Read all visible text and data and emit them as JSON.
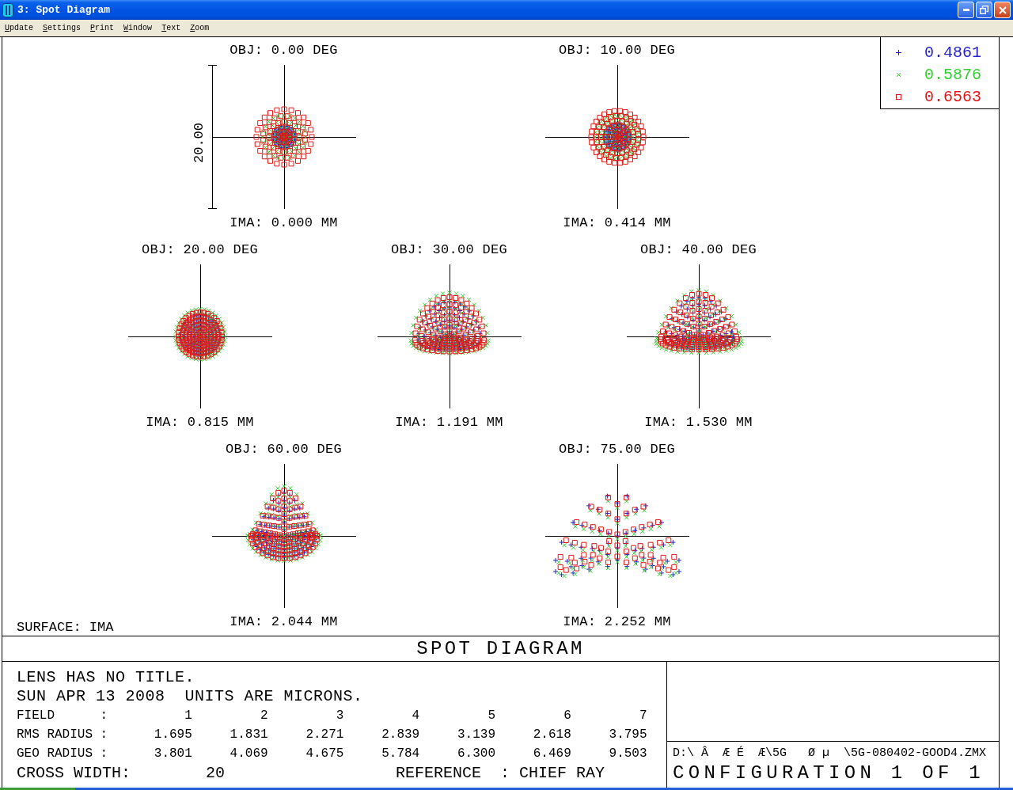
{
  "window": {
    "title": "3: Spot Diagram"
  },
  "menu": [
    "Update",
    "Settings",
    "Print",
    "Window",
    "Text",
    "Zoom"
  ],
  "plot": {
    "scale_label": "20.00",
    "surface": "SURFACE: IMA",
    "fields": [
      {
        "title": "OBJ: 0.00 DEG",
        "image_height": "IMA: 0.000 MM"
      },
      {
        "title": "OBJ: 10.00 DEG",
        "image_height": "IMA: 0.414 MM"
      },
      {
        "title": "OBJ: 20.00 DEG",
        "image_height": "IMA: 0.815 MM"
      },
      {
        "title": "OBJ: 30.00 DEG",
        "image_height": "IMA: 1.191 MM"
      },
      {
        "title": "OBJ: 40.00 DEG",
        "image_height": "IMA: 1.530 MM"
      },
      {
        "title": "OBJ: 60.00 DEG",
        "image_height": "IMA: 2.044 MM"
      },
      {
        "title": "OBJ: 75.00 DEG",
        "image_height": "IMA: 2.252 MM"
      }
    ]
  },
  "legend": [
    {
      "kind": "plus",
      "label": "0.4861",
      "color": "#2424c8"
    },
    {
      "kind": "cross",
      "label": "0.5876",
      "color": "#30d030"
    },
    {
      "kind": "square",
      "label": "0.6563",
      "color": "#e01818"
    }
  ],
  "title_strip": "SPOT DIAGRAM",
  "info": {
    "lines": [
      "LENS HAS NO TITLE.",
      "SUN APR 13 2008  UNITS ARE MICRONS."
    ],
    "table": [
      {
        "label": "FIELD      :",
        "values": [
          "1",
          "2",
          "3",
          "4",
          "5",
          "6",
          "7"
        ]
      },
      {
        "label": "RMS RADIUS :",
        "values": [
          "1.695",
          "1.831",
          "2.271",
          "2.839",
          "3.139",
          "2.618",
          "3.795"
        ]
      },
      {
        "label": "GEO RADIUS :",
        "values": [
          "3.801",
          "4.069",
          "4.675",
          "5.784",
          "6.300",
          "6.469",
          "9.503"
        ]
      }
    ],
    "cross_width": {
      "label": "CROSS WIDTH:",
      "value": "20"
    },
    "reference": "REFERENCE  : CHIEF RAY"
  },
  "file_box": {
    "path": "D:\\ Â  Æ É  Æ\\5G   Ø µ  \\5G-080402-GOOD4.ZMX",
    "configuration": "CONFIGURATION 1 OF 1"
  }
}
